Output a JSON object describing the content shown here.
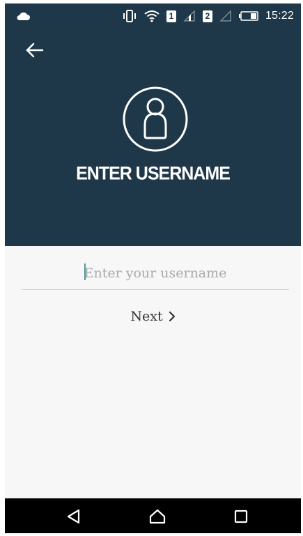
{
  "status_bar": {
    "time": "15:22",
    "sim1_label": "1",
    "sim2_label": "2",
    "icons": [
      "cloud-icon",
      "vibrate-icon",
      "wifi-icon",
      "signal-icon",
      "battery-icon"
    ]
  },
  "header": {
    "back_icon": "arrow-left-icon",
    "avatar_icon": "user-icon",
    "title": "ENTER USERNAME",
    "background_color": "#1f3849"
  },
  "form": {
    "username": {
      "value": "",
      "placeholder": "Enter your username"
    },
    "next_label": "Next",
    "next_icon": "chevron-right-icon"
  },
  "nav_bar": {
    "icons": [
      "back-triangle-icon",
      "home-icon",
      "recents-icon"
    ]
  }
}
